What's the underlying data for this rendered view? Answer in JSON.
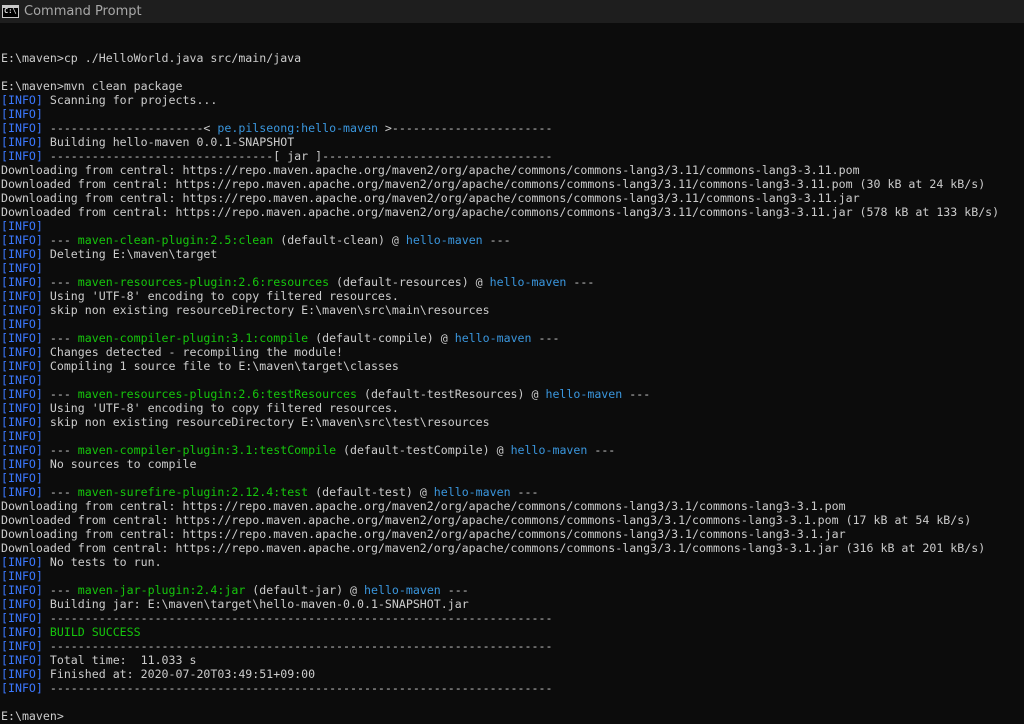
{
  "window": {
    "title": "Command Prompt",
    "icon": "cmd-icon",
    "colors": {
      "background": "#0c0c0c",
      "text": "#cccccc",
      "info": "#3b78ff",
      "plugin": "#16c60c",
      "project": "#3a96dd"
    }
  },
  "console": {
    "lines": [
      {
        "segments": [
          {
            "t": ""
          }
        ]
      },
      {
        "segments": [
          {
            "t": "E:\\maven>cp ./HelloWorld.java src/main/java"
          }
        ]
      },
      {
        "segments": [
          {
            "t": ""
          }
        ]
      },
      {
        "segments": [
          {
            "t": "E:\\maven>mvn clean package"
          }
        ]
      },
      {
        "segments": [
          {
            "t": "[INFO]",
            "c": "info"
          },
          {
            "t": " Scanning for projects..."
          }
        ]
      },
      {
        "segments": [
          {
            "t": "[INFO]",
            "c": "info"
          }
        ]
      },
      {
        "segments": [
          {
            "t": "[INFO]",
            "c": "info"
          },
          {
            "t": " ----------------------< "
          },
          {
            "t": "pe.pilseong:hello-maven",
            "c": "blue"
          },
          {
            "t": " >-----------------------"
          }
        ]
      },
      {
        "segments": [
          {
            "t": "[INFO]",
            "c": "info"
          },
          {
            "t": " Building hello-maven 0.0.1-SNAPSHOT"
          }
        ]
      },
      {
        "segments": [
          {
            "t": "[INFO]",
            "c": "info"
          },
          {
            "t": " --------------------------------[ jar ]---------------------------------"
          }
        ]
      },
      {
        "segments": [
          {
            "t": "Downloading from central: https://repo.maven.apache.org/maven2/org/apache/commons/commons-lang3/3.11/commons-lang3-3.11.pom"
          }
        ]
      },
      {
        "segments": [
          {
            "t": "Downloaded from central: https://repo.maven.apache.org/maven2/org/apache/commons/commons-lang3/3.11/commons-lang3-3.11.pom (30 kB at 24 kB/s)"
          }
        ]
      },
      {
        "segments": [
          {
            "t": "Downloading from central: https://repo.maven.apache.org/maven2/org/apache/commons/commons-lang3/3.11/commons-lang3-3.11.jar"
          }
        ]
      },
      {
        "segments": [
          {
            "t": "Downloaded from central: https://repo.maven.apache.org/maven2/org/apache/commons/commons-lang3/3.11/commons-lang3-3.11.jar (578 kB at 133 kB/s)"
          }
        ]
      },
      {
        "segments": [
          {
            "t": "[INFO]",
            "c": "info"
          }
        ]
      },
      {
        "segments": [
          {
            "t": "[INFO]",
            "c": "info"
          },
          {
            "t": " --- "
          },
          {
            "t": "maven-clean-plugin:2.5:clean",
            "c": "green"
          },
          {
            "t": " (default-clean) @ "
          },
          {
            "t": "hello-maven",
            "c": "blue"
          },
          {
            "t": " ---"
          }
        ]
      },
      {
        "segments": [
          {
            "t": "[INFO]",
            "c": "info"
          },
          {
            "t": " Deleting E:\\maven\\target"
          }
        ]
      },
      {
        "segments": [
          {
            "t": "[INFO]",
            "c": "info"
          }
        ]
      },
      {
        "segments": [
          {
            "t": "[INFO]",
            "c": "info"
          },
          {
            "t": " --- "
          },
          {
            "t": "maven-resources-plugin:2.6:resources",
            "c": "green"
          },
          {
            "t": " (default-resources) @ "
          },
          {
            "t": "hello-maven",
            "c": "blue"
          },
          {
            "t": " ---"
          }
        ]
      },
      {
        "segments": [
          {
            "t": "[INFO]",
            "c": "info"
          },
          {
            "t": " Using 'UTF-8' encoding to copy filtered resources."
          }
        ]
      },
      {
        "segments": [
          {
            "t": "[INFO]",
            "c": "info"
          },
          {
            "t": " skip non existing resourceDirectory E:\\maven\\src\\main\\resources"
          }
        ]
      },
      {
        "segments": [
          {
            "t": "[INFO]",
            "c": "info"
          }
        ]
      },
      {
        "segments": [
          {
            "t": "[INFO]",
            "c": "info"
          },
          {
            "t": " --- "
          },
          {
            "t": "maven-compiler-plugin:3.1:compile",
            "c": "green"
          },
          {
            "t": " (default-compile) @ "
          },
          {
            "t": "hello-maven",
            "c": "blue"
          },
          {
            "t": " ---"
          }
        ]
      },
      {
        "segments": [
          {
            "t": "[INFO]",
            "c": "info"
          },
          {
            "t": " Changes detected - recompiling the module!"
          }
        ]
      },
      {
        "segments": [
          {
            "t": "[INFO]",
            "c": "info"
          },
          {
            "t": " Compiling 1 source file to E:\\maven\\target\\classes"
          }
        ]
      },
      {
        "segments": [
          {
            "t": "[INFO]",
            "c": "info"
          }
        ]
      },
      {
        "segments": [
          {
            "t": "[INFO]",
            "c": "info"
          },
          {
            "t": " --- "
          },
          {
            "t": "maven-resources-plugin:2.6:testResources",
            "c": "green"
          },
          {
            "t": " (default-testResources) @ "
          },
          {
            "t": "hello-maven",
            "c": "blue"
          },
          {
            "t": " ---"
          }
        ]
      },
      {
        "segments": [
          {
            "t": "[INFO]",
            "c": "info"
          },
          {
            "t": " Using 'UTF-8' encoding to copy filtered resources."
          }
        ]
      },
      {
        "segments": [
          {
            "t": "[INFO]",
            "c": "info"
          },
          {
            "t": " skip non existing resourceDirectory E:\\maven\\src\\test\\resources"
          }
        ]
      },
      {
        "segments": [
          {
            "t": "[INFO]",
            "c": "info"
          }
        ]
      },
      {
        "segments": [
          {
            "t": "[INFO]",
            "c": "info"
          },
          {
            "t": " --- "
          },
          {
            "t": "maven-compiler-plugin:3.1:testCompile",
            "c": "green"
          },
          {
            "t": " (default-testCompile) @ "
          },
          {
            "t": "hello-maven",
            "c": "blue"
          },
          {
            "t": " ---"
          }
        ]
      },
      {
        "segments": [
          {
            "t": "[INFO]",
            "c": "info"
          },
          {
            "t": " No sources to compile"
          }
        ]
      },
      {
        "segments": [
          {
            "t": "[INFO]",
            "c": "info"
          }
        ]
      },
      {
        "segments": [
          {
            "t": "[INFO]",
            "c": "info"
          },
          {
            "t": " --- "
          },
          {
            "t": "maven-surefire-plugin:2.12.4:test",
            "c": "green"
          },
          {
            "t": " (default-test) @ "
          },
          {
            "t": "hello-maven",
            "c": "blue"
          },
          {
            "t": " ---"
          }
        ]
      },
      {
        "segments": [
          {
            "t": "Downloading from central: https://repo.maven.apache.org/maven2/org/apache/commons/commons-lang3/3.1/commons-lang3-3.1.pom"
          }
        ]
      },
      {
        "segments": [
          {
            "t": "Downloaded from central: https://repo.maven.apache.org/maven2/org/apache/commons/commons-lang3/3.1/commons-lang3-3.1.pom (17 kB at 54 kB/s)"
          }
        ]
      },
      {
        "segments": [
          {
            "t": "Downloading from central: https://repo.maven.apache.org/maven2/org/apache/commons/commons-lang3/3.1/commons-lang3-3.1.jar"
          }
        ]
      },
      {
        "segments": [
          {
            "t": "Downloaded from central: https://repo.maven.apache.org/maven2/org/apache/commons/commons-lang3/3.1/commons-lang3-3.1.jar (316 kB at 201 kB/s)"
          }
        ]
      },
      {
        "segments": [
          {
            "t": "[INFO]",
            "c": "info"
          },
          {
            "t": " No tests to run."
          }
        ]
      },
      {
        "segments": [
          {
            "t": "[INFO]",
            "c": "info"
          }
        ]
      },
      {
        "segments": [
          {
            "t": "[INFO]",
            "c": "info"
          },
          {
            "t": " --- "
          },
          {
            "t": "maven-jar-plugin:2.4:jar",
            "c": "green"
          },
          {
            "t": " (default-jar) @ "
          },
          {
            "t": "hello-maven",
            "c": "blue"
          },
          {
            "t": " ---"
          }
        ]
      },
      {
        "segments": [
          {
            "t": "[INFO]",
            "c": "info"
          },
          {
            "t": " Building jar: E:\\maven\\target\\hello-maven-0.0.1-SNAPSHOT.jar"
          }
        ]
      },
      {
        "segments": [
          {
            "t": "[INFO]",
            "c": "info"
          },
          {
            "t": " ------------------------------------------------------------------------"
          }
        ]
      },
      {
        "segments": [
          {
            "t": "[INFO]",
            "c": "info"
          },
          {
            "t": " "
          },
          {
            "t": "BUILD SUCCESS",
            "c": "green"
          }
        ]
      },
      {
        "segments": [
          {
            "t": "[INFO]",
            "c": "info"
          },
          {
            "t": " ------------------------------------------------------------------------"
          }
        ]
      },
      {
        "segments": [
          {
            "t": "[INFO]",
            "c": "info"
          },
          {
            "t": " Total time:  11.033 s"
          }
        ]
      },
      {
        "segments": [
          {
            "t": "[INFO]",
            "c": "info"
          },
          {
            "t": " Finished at: 2020-07-20T03:49:51+09:00"
          }
        ]
      },
      {
        "segments": [
          {
            "t": "[INFO]",
            "c": "info"
          },
          {
            "t": " ------------------------------------------------------------------------"
          }
        ]
      },
      {
        "segments": [
          {
            "t": ""
          }
        ]
      },
      {
        "segments": [
          {
            "t": "E:\\maven>"
          }
        ]
      }
    ]
  }
}
